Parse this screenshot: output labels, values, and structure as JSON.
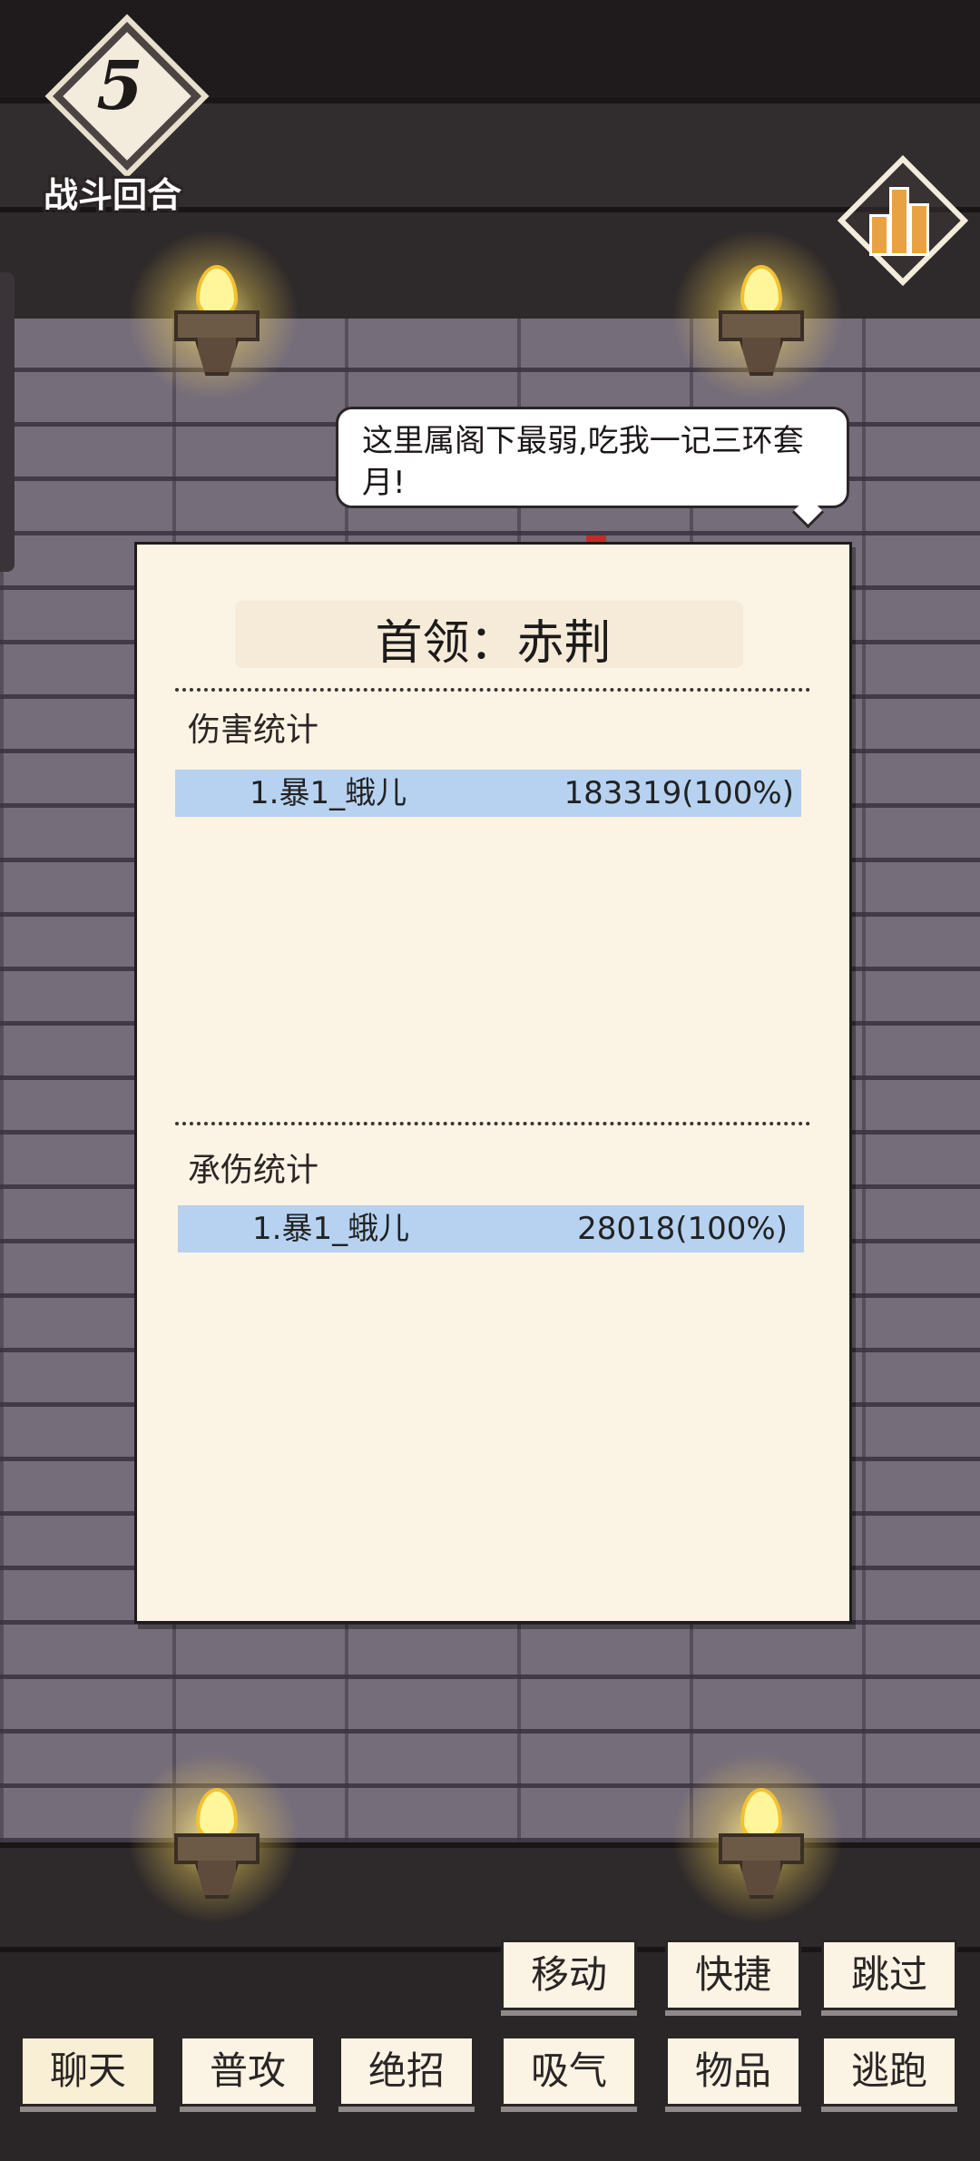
{
  "battle": {
    "round_number": "5",
    "round_label": "战斗回合"
  },
  "stats_button": {
    "icon": "bar-chart-icon"
  },
  "speech": {
    "text": "这里属阁下最弱,吃我一记三环套月!"
  },
  "panel": {
    "title": "首领：赤荆",
    "damage": {
      "label": "伤害统计",
      "rows": [
        {
          "name": "1.暴1_蛾儿",
          "value": "183319(100%)"
        }
      ]
    },
    "taken": {
      "label": "承伤统计",
      "rows": [
        {
          "name": "1.暴1_蛾儿",
          "value": "28018(100%)"
        }
      ]
    }
  },
  "actions": {
    "move": "移动",
    "quick": "快捷",
    "skip": "跳过",
    "chat": "聊天",
    "attack": "普攻",
    "ultimate": "绝招",
    "breathe": "吸气",
    "items": "物品",
    "flee": "逃跑"
  }
}
